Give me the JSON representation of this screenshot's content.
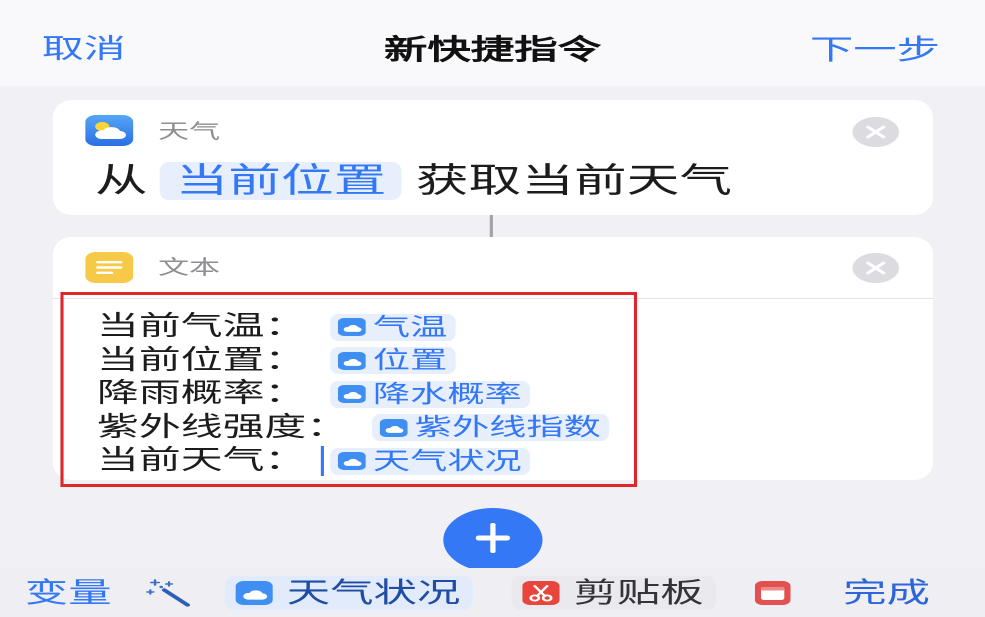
{
  "nav": {
    "cancel_label": "取消",
    "title": "新快捷指令",
    "next_label": "下一步"
  },
  "weather_action": {
    "app_name": "天气",
    "app_icon": "weather-icon",
    "prefix": "从",
    "location_token": "当前位置",
    "suffix": "获取当前天气",
    "remove_icon": "close-icon"
  },
  "text_action": {
    "app_name": "文本",
    "app_icon": "text-icon",
    "remove_icon": "close-icon",
    "lines": [
      {
        "label": "当前气温：",
        "token": "气温",
        "token_icon": "weather-icon"
      },
      {
        "label": "当前位置：",
        "token": "位置",
        "token_icon": "weather-icon"
      },
      {
        "label": "降雨概率：",
        "token": "降水概率",
        "token_icon": "weather-icon"
      },
      {
        "label": "紫外线强度：",
        "token": "紫外线指数",
        "token_icon": "weather-icon"
      },
      {
        "label": "当前天气：",
        "token": "天气状况",
        "token_icon": "weather-icon"
      }
    ]
  },
  "add_button_icon": "plus-icon",
  "toolbar": {
    "variables_label": "变量",
    "magic_variable_icon": "magic-wand-icon",
    "suggestions": [
      {
        "label": "天气状况",
        "icon": "weather-icon"
      },
      {
        "label": "剪贴板",
        "icon": "scissors-icon"
      },
      {
        "icon": "calendar-icon"
      }
    ],
    "done_label": "完成"
  },
  "colors": {
    "accent_blue": "#3478f6",
    "token_background": "#e7effd",
    "highlight_red": "#e0262b",
    "page_background": "#f1f1f5"
  }
}
